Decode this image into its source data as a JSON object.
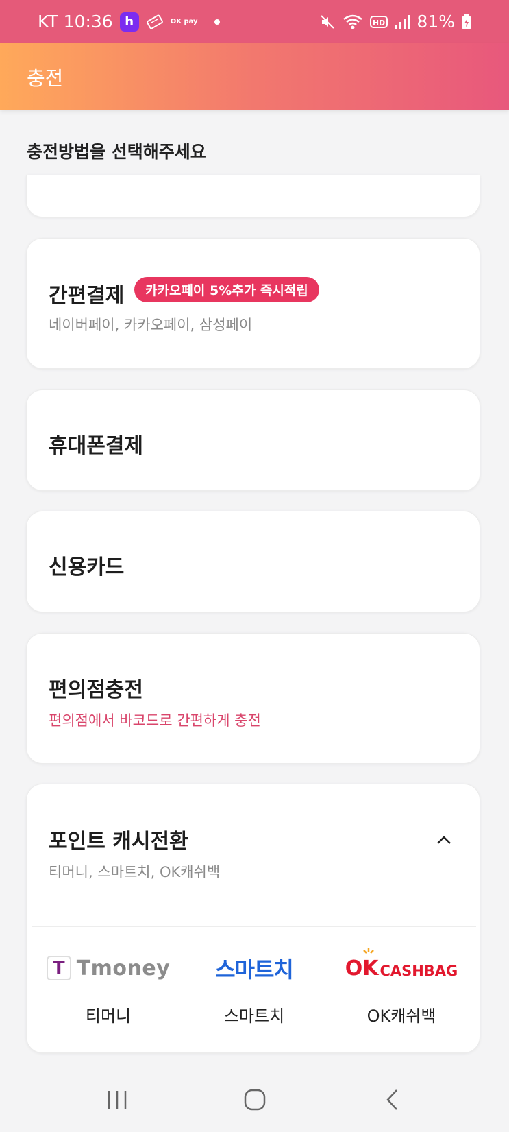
{
  "status_bar": {
    "carrier_time": "KT 10:36",
    "h_badge": "h",
    "ok_pay": "OK pay",
    "battery": "81%",
    "icons": [
      "h-app-icon",
      "ticket-icon",
      "okpay-icon",
      "notification-dot",
      "mute-icon",
      "wifi-icon",
      "hd-icon",
      "signal-icon",
      "battery-charging-icon"
    ]
  },
  "app_bar": {
    "title": "충전"
  },
  "heading": "충전방법을 선택해주세요",
  "methods": [
    {
      "title": "간편결제",
      "promo": "카카오페이 5%추가 즉시적립",
      "subtitle": "네이버페이, 카카오페이, 삼성페이"
    },
    {
      "title": "휴대폰결제"
    },
    {
      "title": "신용카드"
    },
    {
      "title": "편의점충전",
      "subtitle": "편의점에서 바코드로 간편하게 충전"
    },
    {
      "title": "포인트 캐시전환",
      "subtitle": "티머니, 스마트치, OK캐쉬백"
    }
  ],
  "partners": [
    {
      "logo_text": "Tmoney",
      "logo_mark": "T",
      "label": "티머니"
    },
    {
      "logo_text": "스마트치",
      "label": "스마트치"
    },
    {
      "logo_ok": "OK",
      "logo_text": "CASHBAG",
      "label": "OK캐쉬백"
    }
  ],
  "colors": {
    "status_bar": "#e55a79",
    "gradient_start": "#ffa95a",
    "gradient_end": "#e8587c",
    "promo_badge": "#e8365f",
    "pink_text": "#d9456b"
  },
  "nav_bar": {
    "icons": [
      "recent-apps-icon",
      "home-icon",
      "back-icon"
    ]
  }
}
